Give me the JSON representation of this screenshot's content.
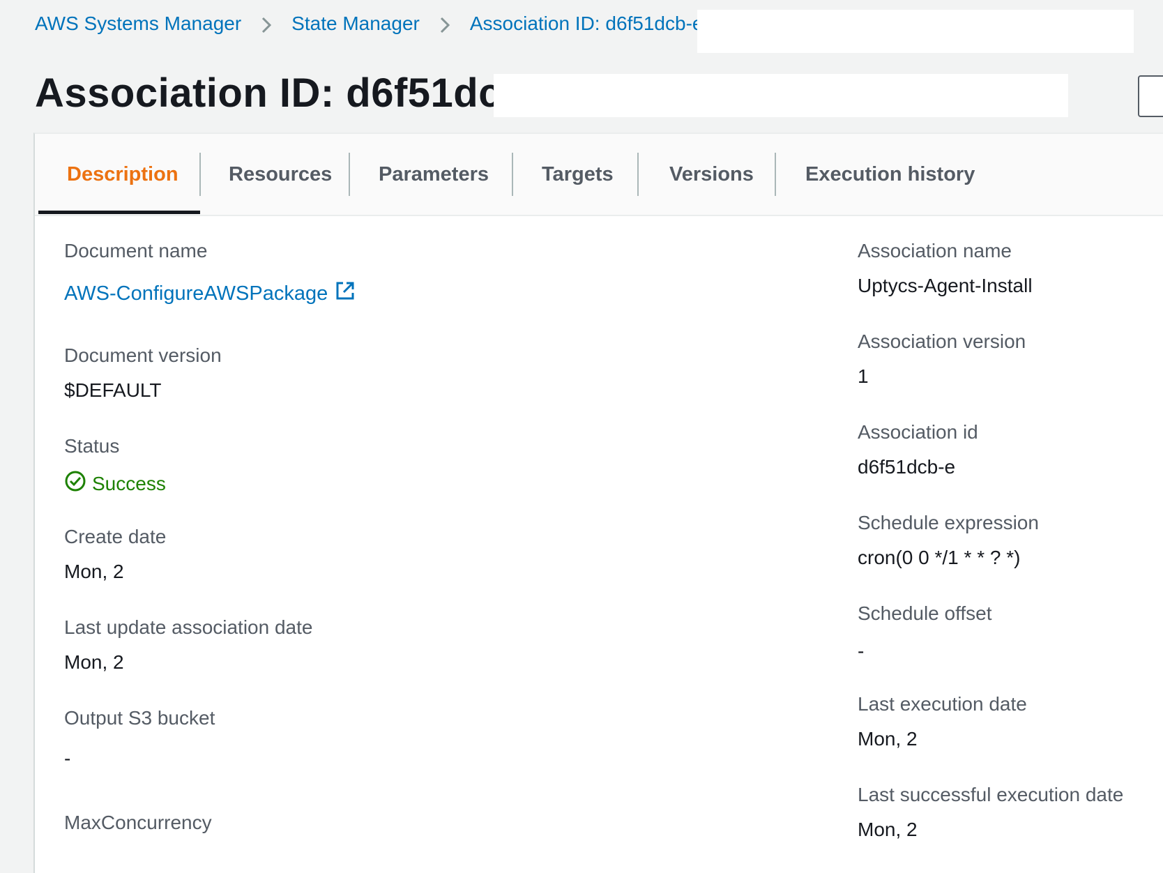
{
  "breadcrumb": {
    "item1": "AWS Systems Manager",
    "item2": "State Manager",
    "item3": "Association ID: d6f51dcb-е"
  },
  "title": "Association ID: d6f51dcb-е",
  "tabs": [
    "Description",
    "Resources",
    "Parameters",
    "Targets",
    "Versions",
    "Execution history"
  ],
  "active_tab": "Description",
  "left_fields": {
    "document_name": {
      "label": "Document name",
      "value": "AWS-ConfigureAWSPackage"
    },
    "document_version": {
      "label": "Document version",
      "value": "$DEFAULT"
    },
    "status": {
      "label": "Status",
      "value": "Success"
    },
    "create_date": {
      "label": "Create date",
      "value": "Mon, 2"
    },
    "last_update": {
      "label": "Last update association date",
      "value": "Mon, 2"
    },
    "output_s3": {
      "label": "Output S3 bucket",
      "value": "-"
    },
    "max_concurrency": {
      "label": "MaxConcurrency",
      "value": ""
    }
  },
  "right_fields": {
    "association_name": {
      "label": "Association name",
      "value": "Uptycs-Agent-Install"
    },
    "association_version": {
      "label": "Association version",
      "value": "1"
    },
    "association_id": {
      "label": "Association id",
      "value": "d6f51dcb-е"
    },
    "schedule_expression": {
      "label": "Schedule expression",
      "value": "cron(0 0 */1 * * ? *)"
    },
    "schedule_offset": {
      "label": "Schedule offset",
      "value": "-"
    },
    "last_execution": {
      "label": "Last execution date",
      "value": "Mon, 2"
    },
    "last_successful_execution": {
      "label": "Last successful execution date",
      "value": "Mon, 2"
    }
  },
  "colors": {
    "link": "#0073bb",
    "active_tab": "#ec7211",
    "success": "#1d8102",
    "label": "#545b64",
    "text": "#16191f",
    "background": "#f2f3f3"
  },
  "icons": {
    "external_link": "external-link-icon",
    "status": "check-circle-icon",
    "separator": "chevron-right-icon"
  }
}
